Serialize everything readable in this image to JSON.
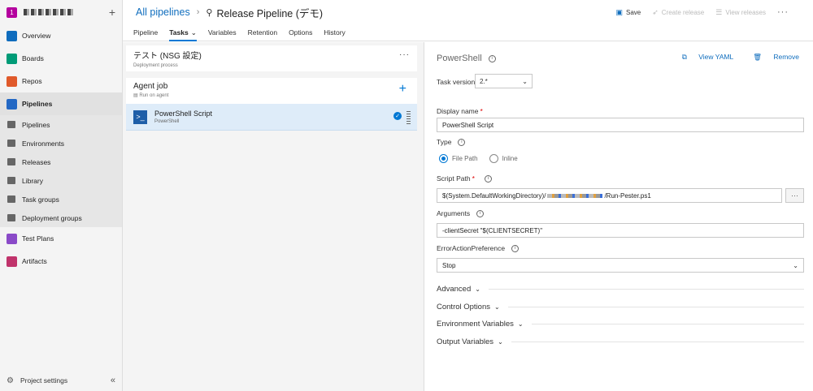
{
  "org": {
    "badge": "1"
  },
  "nav": {
    "items": [
      {
        "label": "Overview",
        "color": "#0f6cbd"
      },
      {
        "label": "Boards",
        "color": "#009b77"
      },
      {
        "label": "Repos",
        "color": "#e05a2b"
      },
      {
        "label": "Pipelines",
        "color": "#2368c4"
      }
    ],
    "pipelines_sub": [
      "Pipelines",
      "Environments",
      "Releases",
      "Library",
      "Task groups",
      "Deployment groups"
    ],
    "after": [
      {
        "label": "Test Plans",
        "color": "#8a4ac8"
      },
      {
        "label": "Artifacts",
        "color": "#c0336b"
      }
    ],
    "project_settings": "Project settings"
  },
  "header": {
    "breadcrumb": "All pipelines",
    "title": "Release Pipeline (デモ)",
    "save": "Save",
    "create_release": "Create release",
    "view_releases": "View releases"
  },
  "tabs": [
    "Pipeline",
    "Tasks",
    "Variables",
    "Retention",
    "Options",
    "History"
  ],
  "stage": {
    "name": "テスト (NSG 設定)",
    "sub": "Deployment process"
  },
  "job": {
    "name": "Agent job",
    "sub": "Run on agent"
  },
  "task": {
    "name": "PowerShell Script",
    "sub": "PowerShell"
  },
  "details": {
    "title": "PowerShell",
    "view_yaml": "View YAML",
    "remove": "Remove",
    "task_version_label": "Task version",
    "task_version": "2.*",
    "display_name_label": "Display name",
    "display_name": "PowerShell Script",
    "type_label": "Type",
    "type_file": "File Path",
    "type_inline": "Inline",
    "script_path_label": "Script Path",
    "script_path_prefix": "$(System.DefaultWorkingDirectory)/",
    "script_path_suffix": "/Run-Pester.ps1",
    "arguments_label": "Arguments",
    "arguments": "-clientSecret \"$(CLIENTSECRET)\"",
    "eap_label": "ErrorActionPreference",
    "eap": "Stop",
    "sections": [
      "Advanced",
      "Control Options",
      "Environment Variables",
      "Output Variables"
    ]
  }
}
